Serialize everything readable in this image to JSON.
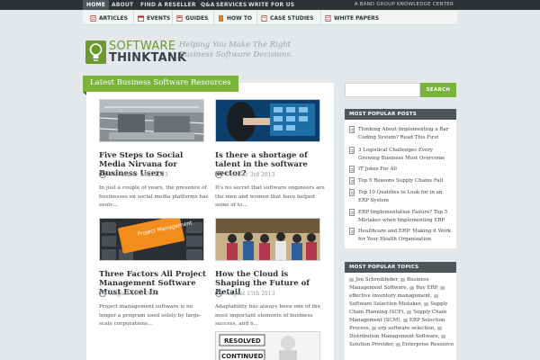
{
  "topnav": {
    "items": [
      "HOME",
      "ABOUT",
      "FIND A RESELLER",
      "Q&A",
      "SERVICES",
      "WRITE FOR US"
    ],
    "right": "A BAND GROUP KNOWLEDGE CENTER"
  },
  "secnav": {
    "items": [
      {
        "label": "ARTICLES",
        "icon": "document-icon"
      },
      {
        "label": "EVENTS",
        "icon": "calendar-icon"
      },
      {
        "label": "GUIDES",
        "icon": "guide-icon"
      },
      {
        "label": "HOW TO",
        "icon": "howto-icon"
      },
      {
        "label": "CASE STUDIES",
        "icon": "case-icon"
      },
      {
        "label": "WHITE PAPERS",
        "icon": "paper-icon"
      }
    ]
  },
  "header": {
    "logo_line1": "SOFTWARE",
    "logo_line2": "THINKTANK",
    "tagline": "Helping You Make The Right Business Software Decisions."
  },
  "main": {
    "banner": "Latest Business Software Resources",
    "articles": [
      {
        "title": "Five Steps to Social Media Nirvana for Business Users",
        "date": "November 25th 2013",
        "excerpt": "In just a couple of years, the presence of businesses on social media platforms has evolv…"
      },
      {
        "title": "Is there a shortage of talent in the software sector?",
        "date": "October 3rd 2013",
        "excerpt": "It's no secret that software engineers are the men and women that have helped some of to…"
      },
      {
        "title": "Three Factors All Project Management Software Must Excel In",
        "date": "August 19th 2013",
        "excerpt": "Project management software is no longer a program used solely by large-scale corporations…"
      },
      {
        "title": "How the Cloud is Shaping the Future of Retail",
        "date": "August 15th 2013",
        "excerpt": "Adaptability has always been one of the most important elements of business success, and n…"
      }
    ],
    "thumb_labels": {
      "keyboard": "Project Management",
      "sign1": "RESOLVED",
      "sign2": "CONTINUED"
    }
  },
  "sidebar": {
    "search_button": "SEARCH",
    "popular_posts_title": "MOST POPULAR POSTS",
    "popular_posts": [
      "Thinking About Implementing a Bar Coding System? Read This First",
      "3 Logistical Challenges Every Growing Business Must Overcome",
      "IT Jokes For All",
      " Top 5 Reasons Supply Chains Fail",
      "Top 10 Qualities to Look for in an ERP System",
      "ERP Implementation Failure? Top 5 Mistakes when Implementing ERP",
      "Healthcare and ERP: Making it Work for Your Health Organization"
    ],
    "popular_topics_title": "MOST POPULAR TOPICS",
    "topics": [
      "Jon Schreibfeder,",
      "Business Management Software,",
      "Buy ERP,",
      "effective inventory management,",
      "Software Selection Mistakes,",
      "Supply Chain Planning (SCP),",
      "Supply Chain Management (SCM),",
      "ERP Selection Process,",
      "erp software selection,",
      "Distribution Management Software,",
      "Solution Provider,",
      "Enterprise Resource"
    ]
  },
  "colors": {
    "accent": "#7ab33a",
    "dark": "#2c3134",
    "widget_head": "#4e5659"
  }
}
